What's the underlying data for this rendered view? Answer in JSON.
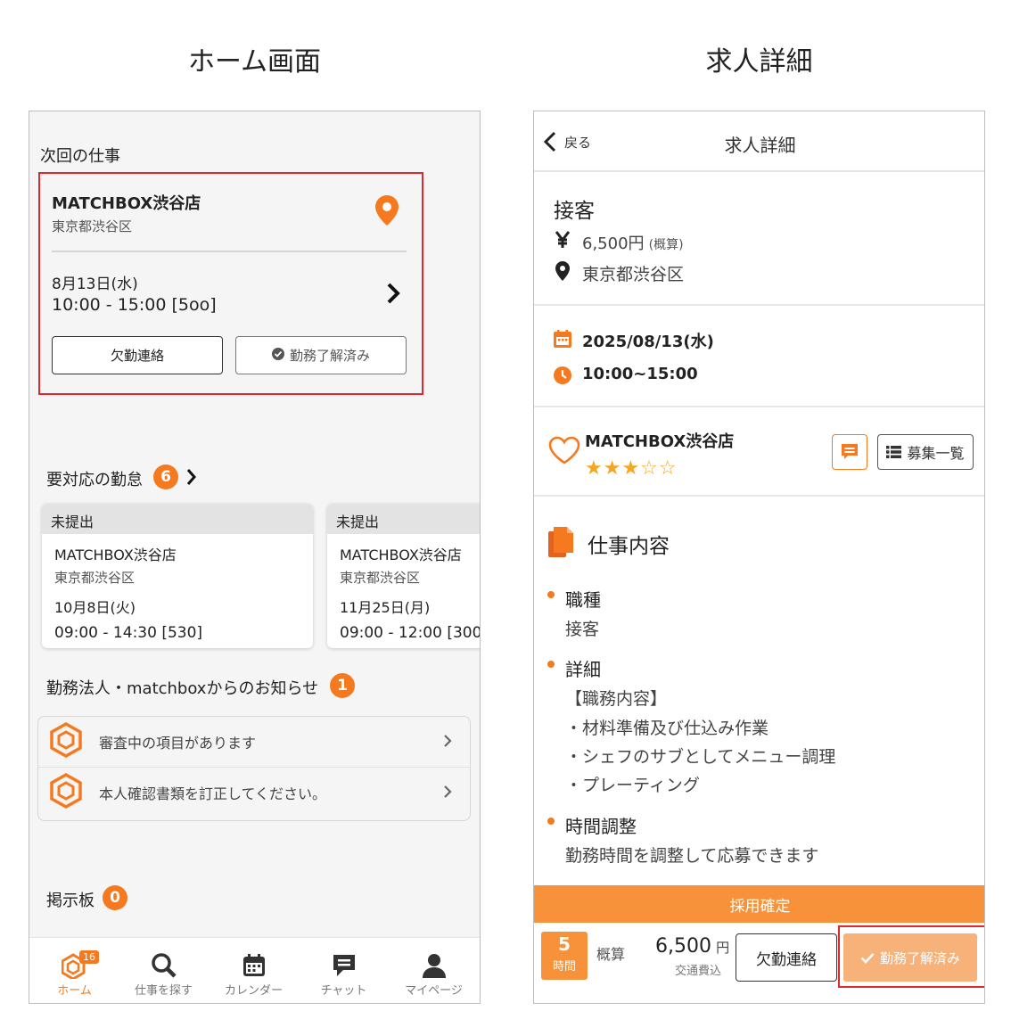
{
  "captions": {
    "left": "ホーム画面",
    "right": "求人詳細"
  },
  "home": {
    "next_job": {
      "section_title": "次回の仕事",
      "shop": "MATCHBOX渋谷店",
      "address": "東京都渋谷区",
      "date": "8月13日(水)",
      "time": "10:00 - 15:00 [5oo]",
      "absence_button": "欠勤連絡",
      "confirmed_button": "勤務了解済み"
    },
    "attendance": {
      "title": "要対応の勤怠",
      "count": "6",
      "cards": [
        {
          "status": "未提出",
          "shop": "MATCHBOX渋谷店",
          "address": "東京都渋谷区",
          "date": "10月8日(火)",
          "time": "09:00 - 14:30 [530]"
        },
        {
          "status": "未提出",
          "shop": "MATCHBOX渋谷店",
          "address": "東京都渋谷区",
          "date": "11月25日(月)",
          "time": "09:00 - 12:00 [300"
        }
      ]
    },
    "notices": {
      "title": "勤務法人・matchboxからのお知らせ",
      "count": "1",
      "items": [
        {
          "text": "審査中の項目があります"
        },
        {
          "text": "本人確認書類を訂正してください。"
        }
      ]
    },
    "board": {
      "title": "掲示板",
      "count": "0"
    },
    "tabbar": {
      "badge": "16",
      "items": [
        {
          "label": "ホーム"
        },
        {
          "label": "仕事を探す"
        },
        {
          "label": "カレンダー"
        },
        {
          "label": "チャット"
        },
        {
          "label": "マイページ"
        }
      ]
    }
  },
  "detail": {
    "back_label": "戻る",
    "title": "求人詳細",
    "job_title": "接客",
    "pay": "6,500円",
    "pay_note": "(概算)",
    "location": "東京都渋谷区",
    "date": "2025/08/13(水)",
    "time": "10:00~15:00",
    "shop": "MATCHBOX渋谷店",
    "rating": "★★★☆☆",
    "rating_value": 3.5,
    "list_button": "募集一覧",
    "section_title": "仕事内容",
    "items": [
      {
        "title": "職種",
        "lines": [
          "接客"
        ]
      },
      {
        "title": "詳細",
        "lines": [
          "【職務内容】",
          "・材料準備及び仕込み作業",
          "・シェフのサブとしてメニュー調理",
          "・プレーティング"
        ]
      },
      {
        "title": "時間調整",
        "lines": [
          "勤務時間を調整して応募できます"
        ]
      }
    ],
    "bottom": {
      "status_bar": "採用確定",
      "hours": "5",
      "hours_unit": "時間",
      "estimate_label": "概算",
      "amount": "6,500",
      "currency": "円",
      "transport": "交通費込",
      "absence_button": "欠勤連絡",
      "confirmed_button": "勤務了解済み"
    }
  },
  "colors": {
    "accent": "#f57a1f",
    "highlight_border": "#e0282e",
    "light_accent": "#f7923a"
  }
}
